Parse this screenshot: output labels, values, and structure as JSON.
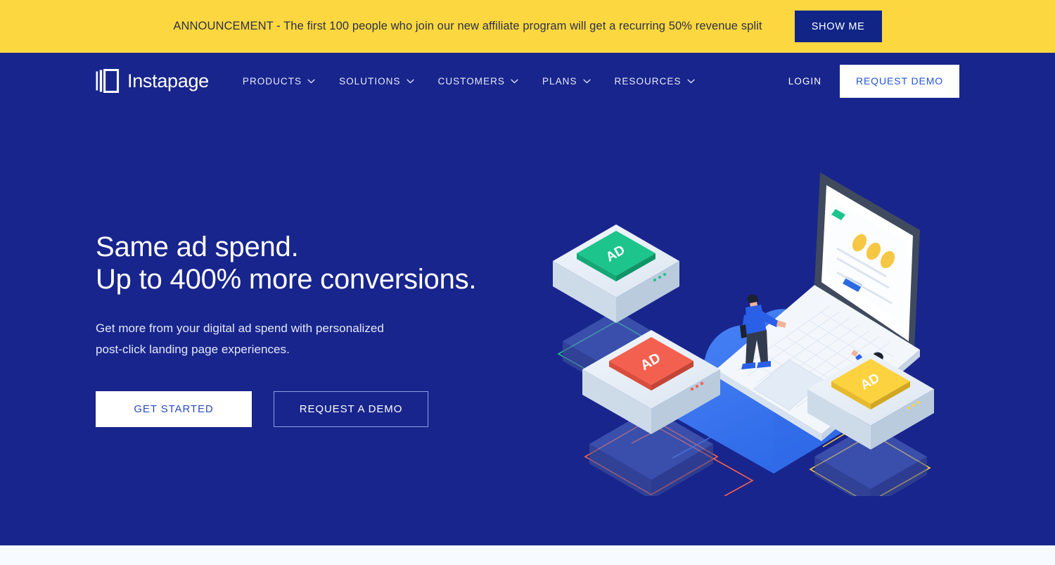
{
  "announcement": {
    "text": "ANNOUNCEMENT - The first 100 people who join our new affiliate program will get a recurring 50% revenue split",
    "button_label": "SHOW ME",
    "bg_color": "#fcd740",
    "button_color": "#102585"
  },
  "nav": {
    "logo_text": "Instapage",
    "logo_icon": "instapage-page-mark-icon",
    "items": [
      {
        "label": "PRODUCTS",
        "icon": "chevron-down-icon"
      },
      {
        "label": "SOLUTIONS",
        "icon": "chevron-down-icon"
      },
      {
        "label": "CUSTOMERS",
        "icon": "chevron-down-icon"
      },
      {
        "label": "PLANS",
        "icon": "chevron-down-icon"
      },
      {
        "label": "RESOURCES",
        "icon": "chevron-down-icon"
      }
    ],
    "login_label": "LOGIN",
    "demo_label": "REQUEST DEMO"
  },
  "hero": {
    "title_line1": "Same ad spend.",
    "title_line2": "Up to 400% more conversions.",
    "subtitle_line1": "Get more from your digital ad spend with personalized",
    "subtitle_line2": "post-click landing page experiences.",
    "primary_cta": "GET STARTED",
    "secondary_cta": "REQUEST A DEMO",
    "bg_color": "#18258d"
  },
  "illustration": {
    "name": "isometric-ad-cloud-laptop-illustration",
    "ad_cards": [
      {
        "label": "AD",
        "color": "#1dc48b",
        "position": "top-left"
      },
      {
        "label": "AD",
        "color": "#f4604f",
        "position": "bottom-left"
      },
      {
        "label": "AD",
        "color": "#fcd23f",
        "position": "bottom-right"
      }
    ],
    "cloud_color": "#3d7cf4",
    "laptop": {
      "screen_accent_bar": "#1dc48b",
      "screen_dots": "#f6c744",
      "screen_button": "#2a6ae0"
    },
    "people": [
      {
        "name": "person-man-pointing",
        "outfit_color": "#2a5fe8"
      },
      {
        "name": "person-woman-pointing",
        "outfit_color": "#2a5fe8"
      }
    ]
  }
}
